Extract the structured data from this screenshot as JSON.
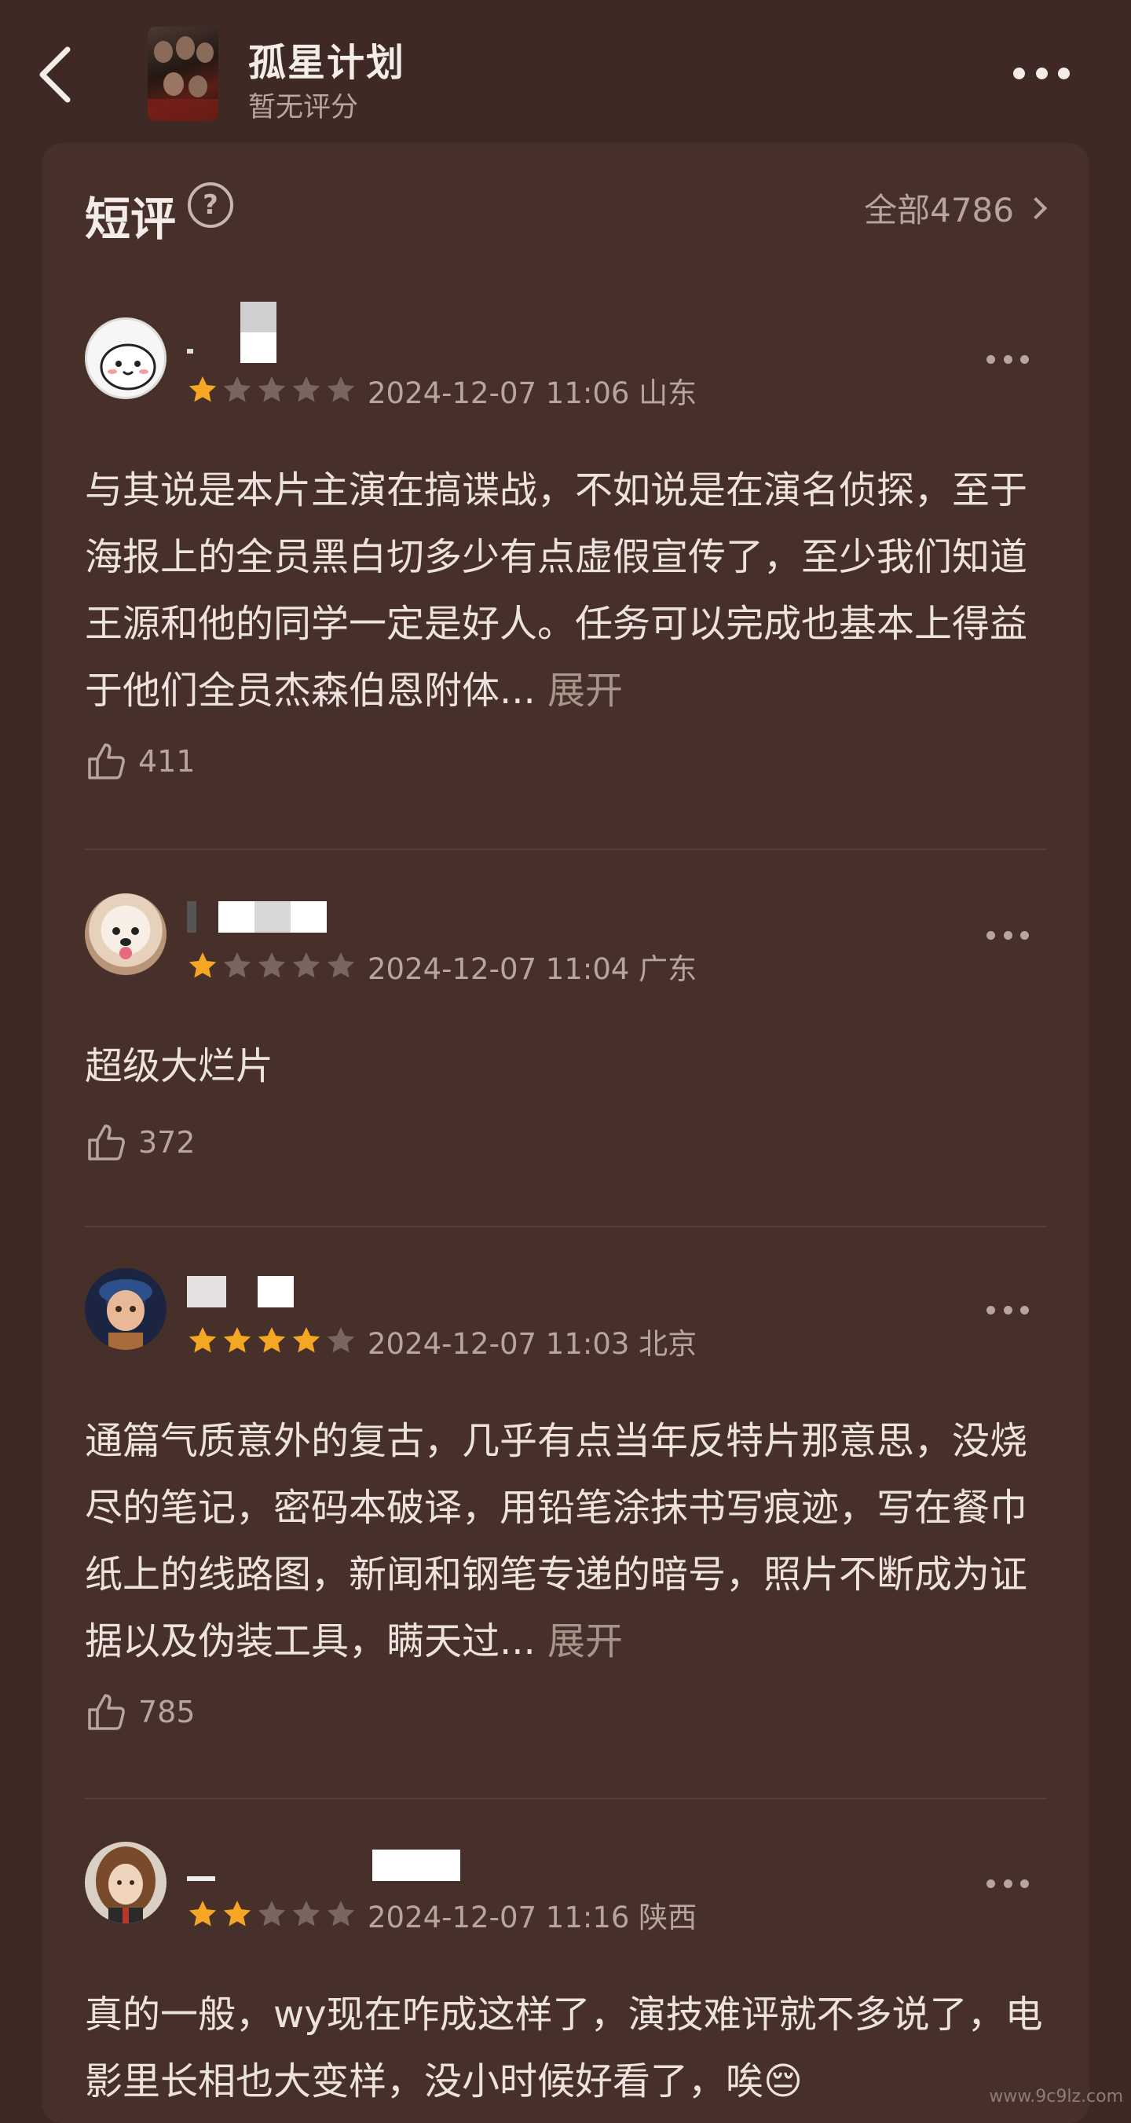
{
  "header": {
    "title": "孤星计划",
    "subtitle": "暂无评分"
  },
  "section": {
    "title": "短评",
    "all_link": "全部4786"
  },
  "reviews": [
    {
      "rating": 1,
      "meta": "2024-12-07 11:06 山东",
      "text": "与其说是本片主演在搞谍战，不如说是在演名侦探，至于海报上的全员黑白切多少有点虚假宣传了，至少我们知道王源和他的同学一定是好人。任务可以完成也基本上得益于他们全员杰森伯恩附体...",
      "expand": "展开",
      "likes": "411"
    },
    {
      "rating": 1,
      "meta": "2024-12-07 11:04 广东",
      "text": "超级大烂片",
      "expand": "",
      "likes": "372"
    },
    {
      "rating": 4,
      "meta": "2024-12-07 11:03 北京",
      "text": "通篇气质意外的复古，几乎有点当年反特片那意思，没烧尽的笔记，密码本破译，用铅笔涂抹书写痕迹，写在餐巾纸上的线路图，新闻和钢笔专递的暗号，照片不断成为证据以及伪装工具，瞒天过...",
      "expand": "展开",
      "likes": "785"
    },
    {
      "rating": 2,
      "meta": "2024-12-07 11:16 陕西",
      "text": "真的一般，wy现在咋成这样了，演技难评就不多说了，电影里长相也大变样，没小时候好看了，唉😔",
      "expand": "",
      "likes": ""
    }
  ],
  "colors": {
    "star_on": "#f5a623",
    "star_off": "#7a6660",
    "background": "#3d2823",
    "card": "#47302a"
  },
  "icons": [
    "back-icon",
    "more-icon",
    "help-icon",
    "chevron-right-icon",
    "star-icon",
    "thumb-up-icon"
  ],
  "watermark": "www.9c9lz.com"
}
